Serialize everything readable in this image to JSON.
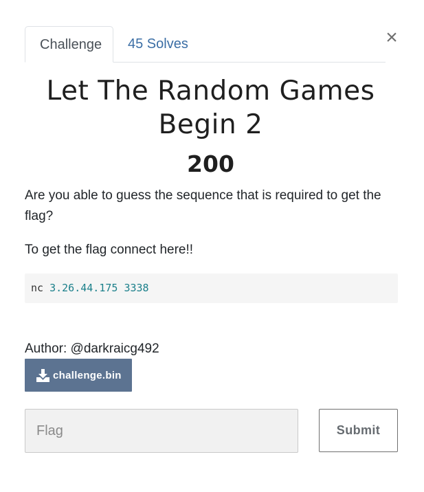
{
  "tabs": [
    {
      "label": "Challenge",
      "active": true
    },
    {
      "label": "45 Solves",
      "active": false
    }
  ],
  "close": {
    "symbol": "×"
  },
  "challenge": {
    "title_line1": "Let The Random Games",
    "title_line2": "Begin 2",
    "points": "200",
    "description": "Are you able to guess the sequence that is required to get the flag?",
    "connect_text": "To get the flag connect here!!",
    "code": {
      "command": "nc",
      "args": "3.26.44.175 3338"
    },
    "author": "Author: @darkraicg492",
    "file": {
      "label": "challenge.bin",
      "icon": "download-icon"
    }
  },
  "form": {
    "flag_placeholder": "Flag",
    "flag_value": "",
    "submit_label": "Submit"
  },
  "colors": {
    "tab_link": "#3b6ea5",
    "download_bg": "#5c7391",
    "code_bg": "#f5f5f5",
    "code_args": "#1a7f8a",
    "input_bg": "#f1f1f1"
  }
}
